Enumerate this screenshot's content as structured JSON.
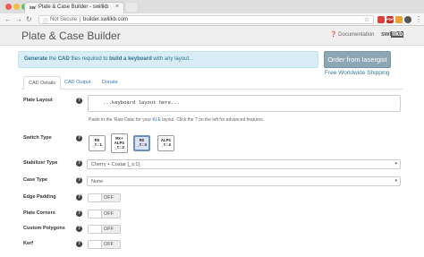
{
  "browser": {
    "tab_title": "Plate & Case Builder - swillkb",
    "tab_favicon": "sw",
    "url_security": "Not Secure",
    "url": "builder.swillkb.com",
    "ext_icons": [
      {
        "name": "opera-extension-icon",
        "label": "",
        "color": "#d9413b"
      },
      {
        "name": "pdf-extension-icon",
        "label": "PDF",
        "color": "#c9302c"
      },
      {
        "name": "mail-extension-icon",
        "label": "",
        "color": "#f0a030"
      },
      {
        "name": "profile-extension-icon",
        "label": "",
        "color": "#555555"
      }
    ]
  },
  "header": {
    "title": "Plate & Case Builder",
    "documentation": "Documentation",
    "brand_prefix": "swi",
    "brand_box": "llkb"
  },
  "alert": {
    "word1": "Generate",
    "text1": " the ",
    "word2": "CAD",
    "text2": " files required to ",
    "word3": "build a keyboard",
    "text3": " with any layout..."
  },
  "order": {
    "button": "Order from lasergist",
    "shipping": "Free Worldwide Shipping"
  },
  "tabs": [
    "CAD Details",
    "CAD Output",
    "Donate"
  ],
  "form": {
    "plate_layout_label": "Plate Layout",
    "plate_layout_value": "...keyboard layout here...",
    "hint_before": "Paste in the 'Raw Data' for your ",
    "hint_link": "KLE",
    "hint_after": " layout. Click the ? on the left for advanced features.",
    "switch_type_label": "Switch Type",
    "switches": [
      {
        "lines": [
          "MX",
          "_t:1"
        ]
      },
      {
        "lines": [
          "MX+",
          "ALPS",
          "_t:2"
        ]
      },
      {
        "lines": [
          "MX",
          "_t:3"
        ]
      },
      {
        "lines": [
          "ALPS",
          "_t:4"
        ]
      }
    ],
    "stabilizer_label": "Stabilizer Type",
    "stabilizer_value": "Cherry + Costar [_s:1]",
    "case_label": "Case Type",
    "case_value": "None",
    "edge_padding_label": "Edge Padding",
    "plate_corners_label": "Plate Corners",
    "custom_polygons_label": "Custom Polygons",
    "kerf_label": "Kerf",
    "toggle_off": "OFF",
    "help_glyph": "?",
    "caret_glyph": "▾"
  },
  "colors": {
    "accent_blue": "#337ab7",
    "alert_bg": "#d9edf7",
    "order_button": "#8da6b6",
    "selected_switch": "#d8e4f4"
  }
}
